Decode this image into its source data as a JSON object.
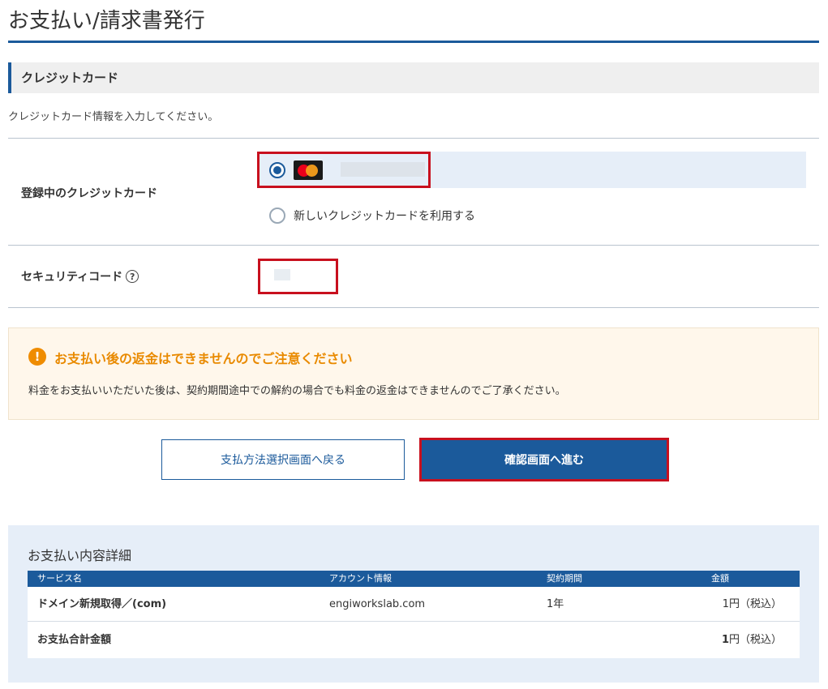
{
  "page": {
    "title": "お支払い/請求書発行"
  },
  "section": {
    "heading": "クレジットカード",
    "description": "クレジットカード情報を入力してください。"
  },
  "registered_card": {
    "label": "登録中のクレジットカード",
    "card_brand_icon": "mastercard-icon",
    "new_card_label": "新しいクレジットカードを利用する",
    "selected": "registered"
  },
  "security": {
    "label": "セキュリティコード",
    "help_icon": "?"
  },
  "notice": {
    "icon": "!",
    "title": "お支払い後の返金はできませんのでご注意ください",
    "text": "料金をお支払いいただいた後は、契約期間途中での解約の場合でも料金の返金はできませんのでご了承ください。"
  },
  "buttons": {
    "back": "支払方法選択画面へ戻る",
    "next": "確認画面へ進む"
  },
  "summary": {
    "title": "お支払い内容詳細",
    "columns": [
      "サービス名",
      "アカウント情報",
      "契約期間",
      "金額"
    ],
    "rows": [
      {
        "service": "ドメイン新規取得／(com)",
        "account": "engiworkslab.com",
        "term": "1年",
        "amount_value": "1",
        "amount_unit": "円（税込）"
      }
    ],
    "total": {
      "label": "お支払合計金額",
      "amount_value": "1",
      "amount_unit": "円（税込）"
    }
  },
  "colors": {
    "brand_blue": "#1b5a9b",
    "highlight_red": "#c8101e",
    "warning_orange": "#ef8c00"
  }
}
